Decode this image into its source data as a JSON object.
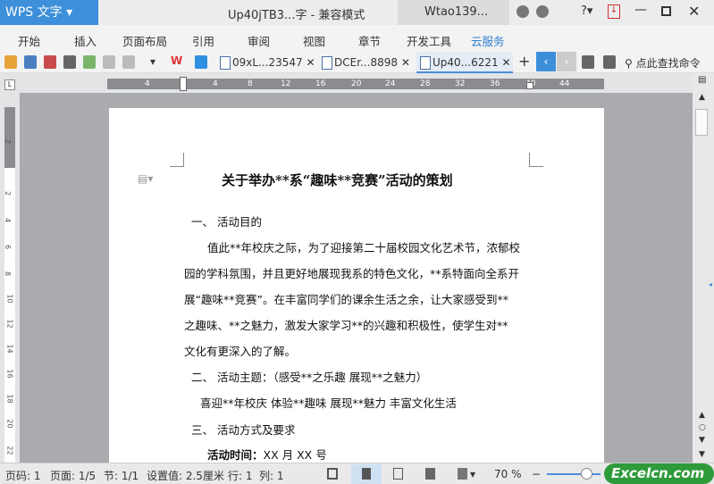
{
  "app": {
    "name": "WPS 文字",
    "doc_title": "Up40jTB3...字 - 兼容模式",
    "user": "Wtao139..."
  },
  "menu": [
    "开始",
    "插入",
    "页面布局",
    "引用",
    "审阅",
    "视图",
    "章节",
    "开发工具",
    "云服务"
  ],
  "tabs": [
    "09xL...23547",
    "DCEr...8898",
    "Up40...6221"
  ],
  "search_placeholder": "点此查找命令",
  "ruler_ticks": [
    "4",
    "4",
    "8",
    "12",
    "16",
    "20",
    "24",
    "28",
    "32",
    "36",
    "40",
    "44"
  ],
  "vruler_ticks": [
    "2",
    "2",
    "4",
    "6",
    "8",
    "10",
    "12",
    "14",
    "16",
    "18",
    "20",
    "22"
  ],
  "document": {
    "title": "关于举办**系“趣味**竞赛”活动的策划",
    "lines": [
      "一、  活动目的",
      "值此**年校庆之际，为了迎接第二十届校园文化艺术节，浓郁校",
      "园的学科氛围，并且更好地展现我系的特色文化，**系特面向全系开",
      "展“趣味**竞赛”。在丰富同学们的课余生活之余，让大家感受到**",
      "之趣味、**之魅力，激发大家学习**的兴趣和积极性，使学生对**",
      "文化有更深入的了解。",
      "二、  活动主题：（感受**之乐趣   展现**之魅力）",
      "喜迎**年校庆   体验**趣味   展现**魅力   丰富文化生活",
      "三、  活动方式及要求"
    ],
    "time_label": "活动时间：",
    "time_value": "XX 月 XX 号"
  },
  "status": {
    "page_no": "页码: 1",
    "pages": "页面: 1/5",
    "section": "节: 1/1",
    "setting": "设置值: 2.5厘米",
    "row": "行: 1",
    "col": "列: 1",
    "zoom": "70 %"
  },
  "watermark": "Excelcn.com"
}
